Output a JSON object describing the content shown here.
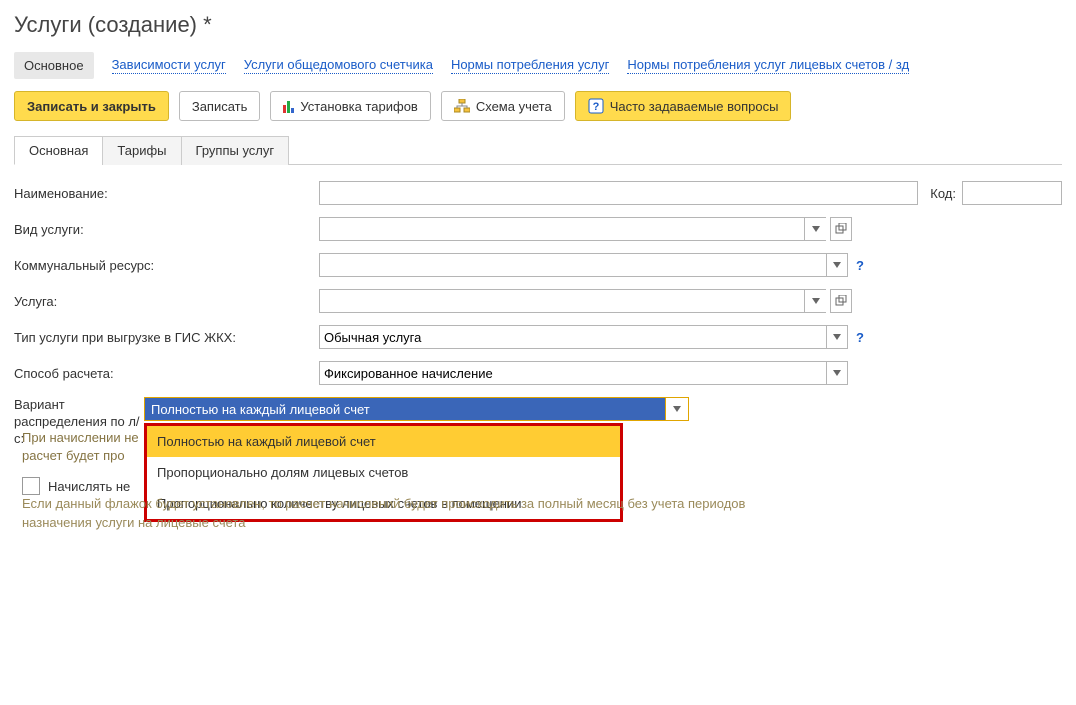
{
  "title": "Услуги (создание) *",
  "topnav": {
    "active": "Основное",
    "links": [
      "Зависимости услуг",
      "Услуги общедомового счетчика",
      "Нормы потребления услуг",
      "Нормы потребления услуг лицевых счетов / зд"
    ]
  },
  "toolbar": {
    "save_close": "Записать и закрыть",
    "save": "Записать",
    "tariffs": "Установка тарифов",
    "scheme": "Схема учета",
    "faq": "Часто задаваемые вопросы"
  },
  "form_tabs": [
    "Основная",
    "Тарифы",
    "Группы услуг"
  ],
  "labels": {
    "name": "Наименование:",
    "code": "Код:",
    "service_type": "Вид услуги:",
    "resource": "Коммунальный ресурс:",
    "service": "Услуга:",
    "gis_type": "Тип услуги при выгрузке в ГИС ЖКХ:",
    "calc_method": "Способ расчета:",
    "variant": "Вариант распределения по л/с:"
  },
  "values": {
    "gis_type": "Обычная услуга",
    "calc_method": "Фиксированное начисление"
  },
  "dropdown": {
    "selected": "Полностью на каждый лицевой счет",
    "options": [
      "Полностью на каждый лицевой счет",
      "Пропорционально долям лицевых счетов",
      "Пропорционально количеству лицевых счетов в помещении"
    ]
  },
  "hints": {
    "h1": "При начислении не",
    "h1b": "расчет будет про",
    "chk": "Начислять не",
    "h2": "Если данный флажок будет установлен, то расчет начислений будет происходить за полный месяц без учета периодов назначения услуги на лицевые счета"
  }
}
